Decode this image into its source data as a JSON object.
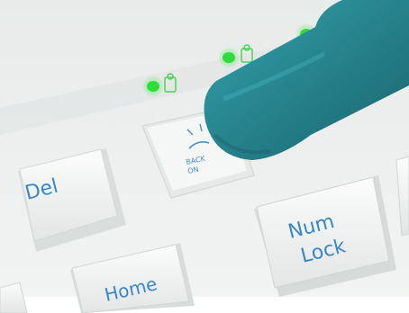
{
  "scene": {
    "kind": "photo",
    "subject": "finger pressing backlight key on white keyboard",
    "colors": {
      "keyboard": "#eef0ef",
      "key_face": "#f7f8f6",
      "legend_blue": "#3a86c8",
      "led_green": "#2edc3a",
      "finger": "#2a8a92"
    }
  },
  "keys": {
    "del": "Del",
    "num": "Num",
    "lock": "Lock",
    "home": "Home",
    "backlight_1": "BACK",
    "backlight_2": "ON"
  },
  "indicators": [
    {
      "icon": "lock-icon",
      "state": "on"
    },
    {
      "icon": "lock-icon",
      "state": "on"
    },
    {
      "icon": "lock-icon",
      "state": "on"
    }
  ]
}
